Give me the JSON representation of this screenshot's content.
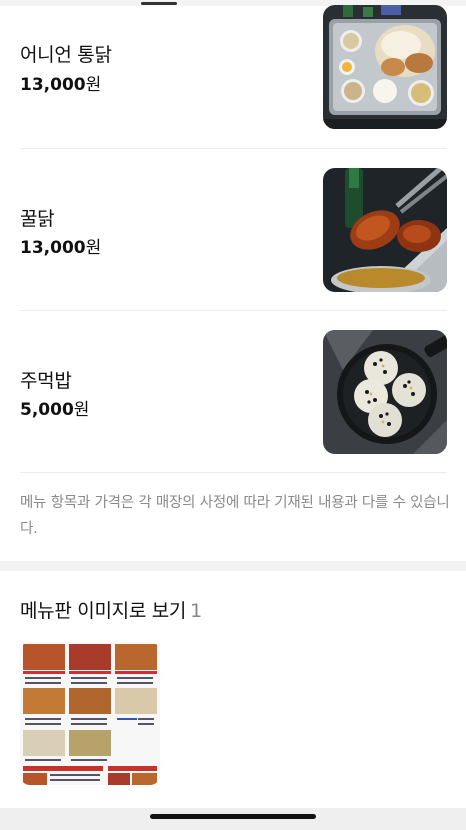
{
  "menu_items": [
    {
      "name": "어니언 통닭",
      "price_number": "13,000",
      "price_unit": "원",
      "image": "onion-chicken-photo"
    },
    {
      "name": "꿀닭",
      "price_number": "13,000",
      "price_unit": "원",
      "image": "honey-chicken-photo"
    },
    {
      "name": "주먹밥",
      "price_number": "5,000",
      "price_unit": "원",
      "image": "rice-ball-photo"
    }
  ],
  "notice": "메뉴 항목과 가격은 각 매장의 사정에 따라 기재된 내용과 다를 수 있습니다.",
  "menu_board": {
    "title": "메뉴판 이미지로 보기",
    "count": "1"
  },
  "colors": {
    "text": "#111111",
    "muted": "#8a8a8a",
    "divider": "#ececec",
    "band": "#f2f2f2"
  }
}
